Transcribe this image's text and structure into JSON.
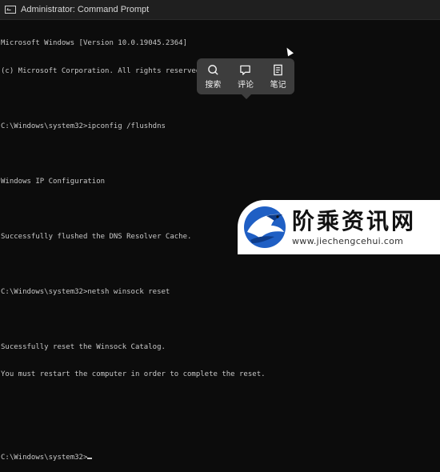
{
  "window": {
    "title": "Administrator: Command Prompt"
  },
  "console": {
    "lines": [
      "Microsoft Windows [Version 10.0.19045.2364]",
      "(c) Microsoft Corporation. All rights reserved.",
      "",
      "C:\\Windows\\system32>ipconfig /flushdns",
      "",
      "Windows IP Configuration",
      "",
      "Successfully flushed the DNS Resolver Cache.",
      "",
      "C:\\Windows\\system32>netsh winsock reset",
      "",
      "Sucessfully reset the Winsock Catalog.",
      "You must restart the computer in order to complete the reset.",
      "",
      "",
      "C:\\Windows\\system32>"
    ]
  },
  "popup": {
    "search_label": "搜索",
    "comment_label": "评论",
    "note_label": "笔记"
  },
  "watermark": {
    "name": "阶乘资讯网",
    "url": "www.jiechengcehui.com"
  },
  "colors": {
    "console_bg": "#0c0c0c",
    "console_text": "#c8c8c8",
    "popup_bg": "#3d3d3d",
    "logo_blue": "#1f5fc4"
  }
}
